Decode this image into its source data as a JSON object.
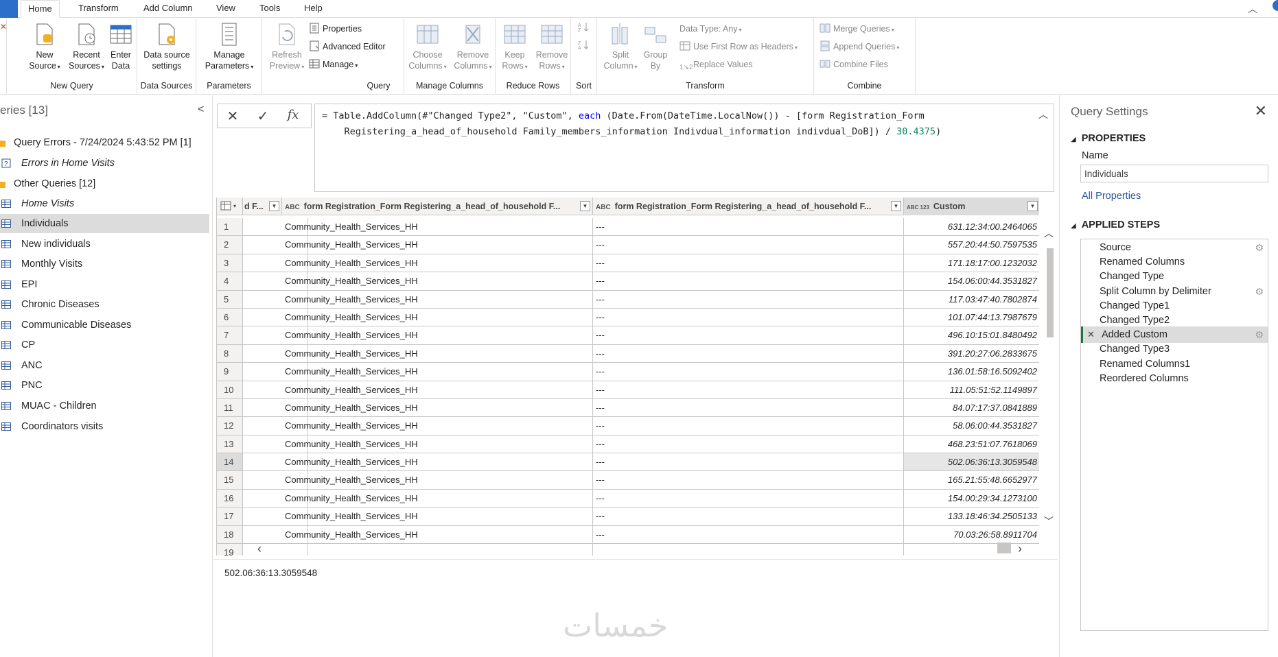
{
  "tabs": [
    "Home",
    "Transform",
    "Add Column",
    "View",
    "Tools",
    "Help"
  ],
  "ribbon": {
    "new_query": {
      "label": "New Query",
      "new_source": "New Source",
      "recent_sources": "Recent Sources",
      "enter_data": "Enter Data"
    },
    "data_sources": {
      "label": "Data Sources",
      "settings": "Data source settings"
    },
    "parameters": {
      "label": "Parameters",
      "manage": "Manage Parameters"
    },
    "query": {
      "label": "Query",
      "refresh": "Refresh Preview",
      "properties": "Properties",
      "advanced_editor": "Advanced Editor",
      "manage": "Manage"
    },
    "manage_columns": {
      "label": "Manage Columns",
      "choose": "Choose Columns",
      "remove": "Remove Columns"
    },
    "reduce_rows": {
      "label": "Reduce Rows",
      "keep": "Keep Rows",
      "remove": "Remove Rows"
    },
    "sort": {
      "label": "Sort"
    },
    "transform": {
      "label": "Transform",
      "split": "Split Column",
      "group_by": "Group By",
      "data_type": "Data Type: Any",
      "first_row": "Use First Row as Headers",
      "replace": "Replace Values"
    },
    "combine": {
      "label": "Combine",
      "merge": "Merge Queries",
      "append": "Append Queries",
      "combine_files": "Combine Files"
    }
  },
  "queries": {
    "title": "eries [13]",
    "items": [
      {
        "label": "Query Errors - 7/24/2024 5:43:52 PM [1]",
        "type": "folder"
      },
      {
        "label": "Errors in Home Visits",
        "type": "error",
        "italic": true
      },
      {
        "label": "Other Queries [12]",
        "type": "folder"
      },
      {
        "label": "Home Visits",
        "type": "table",
        "italic": true
      },
      {
        "label": "Individuals",
        "type": "table",
        "selected": true
      },
      {
        "label": "New individuals",
        "type": "table"
      },
      {
        "label": "Monthly Visits",
        "type": "table"
      },
      {
        "label": "EPI",
        "type": "table"
      },
      {
        "label": "Chronic Diseases",
        "type": "table"
      },
      {
        "label": "Communicable Diseases",
        "type": "table"
      },
      {
        "label": "CP",
        "type": "table"
      },
      {
        "label": "ANC",
        "type": "table"
      },
      {
        "label": "PNC",
        "type": "table"
      },
      {
        "label": "MUAC - Children",
        "type": "table"
      },
      {
        "label": "Coordinators visits",
        "type": "table"
      }
    ]
  },
  "formula": {
    "line1_a": "= Table.AddColumn(#\"Changed Type2\", \"Custom\", ",
    "line1_kw": "each",
    "line1_b": " (Date.From(DateTime.LocalNow()) - [form Registration_Form",
    "line2_a": "    Registering_a_head_of_household Family_members_information Indivdual_information indivdual_DoB]) / ",
    "line2_num": "30.4375",
    "line2_b": ")"
  },
  "grid": {
    "headers": [
      "d F...",
      "form Registration_Form Registering_a_head_of_household F...",
      "form Registration_Form Registering_a_head_of_household F...",
      "Custom"
    ],
    "type_icons": [
      "ABC",
      "ABC",
      "ABC 123"
    ],
    "selected_row": 14,
    "rows": [
      {
        "n": "1",
        "a": "Community_Health_Services_HH",
        "b": "---",
        "custom": "631.12:34:00.2464065"
      },
      {
        "n": "2",
        "a": "Community_Health_Services_HH",
        "b": "---",
        "custom": "557.20:44:50.7597535"
      },
      {
        "n": "3",
        "a": "Community_Health_Services_HH",
        "b": "---",
        "custom": "171.18:17:00.1232032"
      },
      {
        "n": "4",
        "a": "Community_Health_Services_HH",
        "b": "---",
        "custom": "154.06:00:44.3531827"
      },
      {
        "n": "5",
        "a": "Community_Health_Services_HH",
        "b": "---",
        "custom": "117.03:47:40.7802874"
      },
      {
        "n": "6",
        "a": "Community_Health_Services_HH",
        "b": "---",
        "custom": "101.07:44:13.7987679"
      },
      {
        "n": "7",
        "a": "Community_Health_Services_HH",
        "b": "---",
        "custom": "496.10:15:01.8480492"
      },
      {
        "n": "8",
        "a": "Community_Health_Services_HH",
        "b": "---",
        "custom": "391.20:27:06.2833675"
      },
      {
        "n": "9",
        "a": "Community_Health_Services_HH",
        "b": "---",
        "custom": "136.01:58:16.5092402"
      },
      {
        "n": "10",
        "a": "Community_Health_Services_HH",
        "b": "---",
        "custom": "111.05:51:52.1149897"
      },
      {
        "n": "11",
        "a": "Community_Health_Services_HH",
        "b": "---",
        "custom": "84.07:17:37.0841889"
      },
      {
        "n": "12",
        "a": "Community_Health_Services_HH",
        "b": "---",
        "custom": "58.06:00:44.3531827"
      },
      {
        "n": "13",
        "a": "Community_Health_Services_HH",
        "b": "---",
        "custom": "468.23:51:07.7618069"
      },
      {
        "n": "14",
        "a": "Community_Health_Services_HH",
        "b": "---",
        "custom": "502.06:36:13.3059548"
      },
      {
        "n": "15",
        "a": "Community_Health_Services_HH",
        "b": "---",
        "custom": "165.21:55:48.6652977"
      },
      {
        "n": "16",
        "a": "Community_Health_Services_HH",
        "b": "---",
        "custom": "154.00:29:34.1273100"
      },
      {
        "n": "17",
        "a": "Community_Health_Services_HH",
        "b": "---",
        "custom": "133.18:46:34.2505133"
      },
      {
        "n": "18",
        "a": "Community_Health_Services_HH",
        "b": "---",
        "custom": "70.03:26:58.8911704"
      },
      {
        "n": "19",
        "a": "",
        "b": "",
        "custom": ""
      }
    ]
  },
  "cell_value": "502.06:36:13.3059548",
  "watermark": "خمسات",
  "settings": {
    "title": "Query Settings",
    "properties_header": "PROPERTIES",
    "name_label": "Name",
    "name_value": "Individuals",
    "all_properties": "All Properties",
    "steps_header": "APPLIED STEPS",
    "steps": [
      {
        "label": "Source",
        "gear": true
      },
      {
        "label": "Renamed Columns"
      },
      {
        "label": "Changed Type"
      },
      {
        "label": "Split Column by Delimiter",
        "gear": true
      },
      {
        "label": "Changed Type1"
      },
      {
        "label": "Changed Type2"
      },
      {
        "label": "Added Custom",
        "gear": true,
        "selected": true
      },
      {
        "label": "Changed Type3"
      },
      {
        "label": "Renamed Columns1"
      },
      {
        "label": "Reordered Columns"
      }
    ]
  }
}
